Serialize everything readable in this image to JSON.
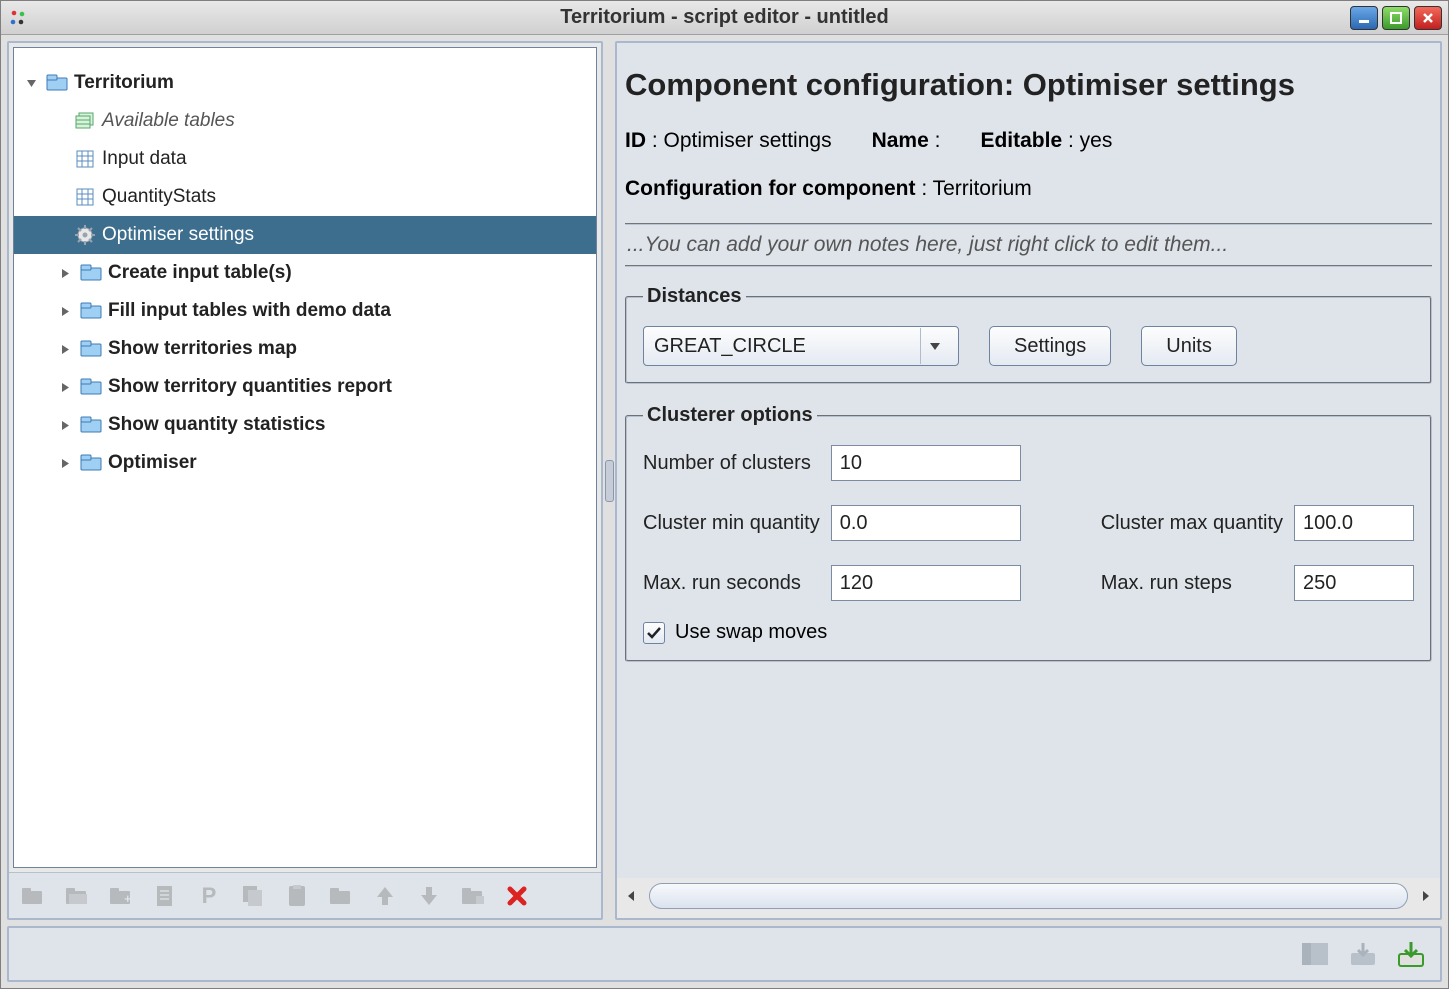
{
  "window": {
    "title": "Territorium - script editor - untitled"
  },
  "tree": {
    "root": "Territorium",
    "available_tables": "Available tables",
    "input_data": "Input data",
    "quantity_stats": "QuantityStats",
    "optimiser_settings": "Optimiser settings",
    "create_input": "Create input table(s)",
    "fill_demo": "Fill input tables with demo data",
    "show_map": "Show territories map",
    "show_report": "Show territory quantities report",
    "show_stats": "Show quantity statistics",
    "optimiser": "Optimiser"
  },
  "toolbar": {
    "p_label": "P"
  },
  "config": {
    "heading": "Component configuration: Optimiser settings",
    "id_label": "ID",
    "id_value": "Optimiser settings",
    "name_label": "Name",
    "name_value": "",
    "editable_label": "Editable",
    "editable_value": "yes",
    "component_for_label": "Configuration for component",
    "component_for_value": "Territorium",
    "notes_placeholder": "...You can add your own notes here, just right click to edit them..."
  },
  "distances": {
    "legend": "Distances",
    "type": "GREAT_CIRCLE",
    "settings_btn": "Settings",
    "units_btn": "Units"
  },
  "clusterer": {
    "legend": "Clusterer options",
    "num_clusters_label": "Number of clusters",
    "num_clusters": "10",
    "min_qty_label": "Cluster min quantity",
    "min_qty": "0.0",
    "max_qty_label": "Cluster max quantity",
    "max_qty": "100.0",
    "max_seconds_label": "Max. run seconds",
    "max_seconds": "120",
    "max_steps_label": "Max. run steps",
    "max_steps": "250",
    "swap_label": "Use swap moves",
    "swap_checked": true
  }
}
